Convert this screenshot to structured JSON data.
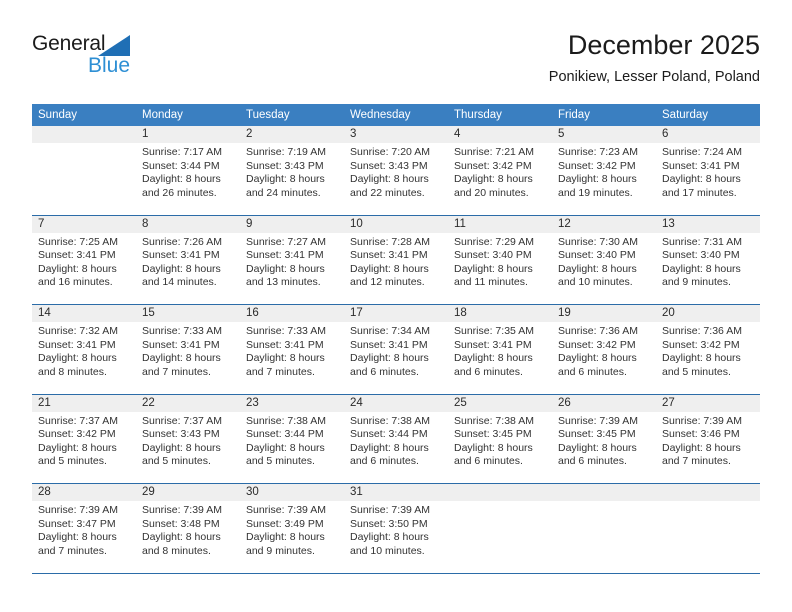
{
  "brand": {
    "name_top": "General",
    "name_bottom": "Blue",
    "accent_color": "#2e8fd4",
    "triangle_color": "#1f6fb5"
  },
  "header": {
    "month_title": "December 2025",
    "location": "Ponikiew, Lesser Poland, Poland"
  },
  "theme": {
    "header_bar_color": "#3a7fc1",
    "row_separator_color": "#2b6ca8",
    "day_band_color": "#efefef"
  },
  "weekdays": [
    "Sunday",
    "Monday",
    "Tuesday",
    "Wednesday",
    "Thursday",
    "Friday",
    "Saturday"
  ],
  "weeks": [
    [
      {
        "day": "",
        "sunrise": "",
        "sunset": "",
        "daylight_line1": "",
        "daylight_line2": "",
        "empty": true
      },
      {
        "day": "1",
        "sunrise": "Sunrise: 7:17 AM",
        "sunset": "Sunset: 3:44 PM",
        "daylight_line1": "Daylight: 8 hours",
        "daylight_line2": "and 26 minutes."
      },
      {
        "day": "2",
        "sunrise": "Sunrise: 7:19 AM",
        "sunset": "Sunset: 3:43 PM",
        "daylight_line1": "Daylight: 8 hours",
        "daylight_line2": "and 24 minutes."
      },
      {
        "day": "3",
        "sunrise": "Sunrise: 7:20 AM",
        "sunset": "Sunset: 3:43 PM",
        "daylight_line1": "Daylight: 8 hours",
        "daylight_line2": "and 22 minutes."
      },
      {
        "day": "4",
        "sunrise": "Sunrise: 7:21 AM",
        "sunset": "Sunset: 3:42 PM",
        "daylight_line1": "Daylight: 8 hours",
        "daylight_line2": "and 20 minutes."
      },
      {
        "day": "5",
        "sunrise": "Sunrise: 7:23 AM",
        "sunset": "Sunset: 3:42 PM",
        "daylight_line1": "Daylight: 8 hours",
        "daylight_line2": "and 19 minutes."
      },
      {
        "day": "6",
        "sunrise": "Sunrise: 7:24 AM",
        "sunset": "Sunset: 3:41 PM",
        "daylight_line1": "Daylight: 8 hours",
        "daylight_line2": "and 17 minutes."
      }
    ],
    [
      {
        "day": "7",
        "sunrise": "Sunrise: 7:25 AM",
        "sunset": "Sunset: 3:41 PM",
        "daylight_line1": "Daylight: 8 hours",
        "daylight_line2": "and 16 minutes."
      },
      {
        "day": "8",
        "sunrise": "Sunrise: 7:26 AM",
        "sunset": "Sunset: 3:41 PM",
        "daylight_line1": "Daylight: 8 hours",
        "daylight_line2": "and 14 minutes."
      },
      {
        "day": "9",
        "sunrise": "Sunrise: 7:27 AM",
        "sunset": "Sunset: 3:41 PM",
        "daylight_line1": "Daylight: 8 hours",
        "daylight_line2": "and 13 minutes."
      },
      {
        "day": "10",
        "sunrise": "Sunrise: 7:28 AM",
        "sunset": "Sunset: 3:41 PM",
        "daylight_line1": "Daylight: 8 hours",
        "daylight_line2": "and 12 minutes."
      },
      {
        "day": "11",
        "sunrise": "Sunrise: 7:29 AM",
        "sunset": "Sunset: 3:40 PM",
        "daylight_line1": "Daylight: 8 hours",
        "daylight_line2": "and 11 minutes."
      },
      {
        "day": "12",
        "sunrise": "Sunrise: 7:30 AM",
        "sunset": "Sunset: 3:40 PM",
        "daylight_line1": "Daylight: 8 hours",
        "daylight_line2": "and 10 minutes."
      },
      {
        "day": "13",
        "sunrise": "Sunrise: 7:31 AM",
        "sunset": "Sunset: 3:40 PM",
        "daylight_line1": "Daylight: 8 hours",
        "daylight_line2": "and 9 minutes."
      }
    ],
    [
      {
        "day": "14",
        "sunrise": "Sunrise: 7:32 AM",
        "sunset": "Sunset: 3:41 PM",
        "daylight_line1": "Daylight: 8 hours",
        "daylight_line2": "and 8 minutes."
      },
      {
        "day": "15",
        "sunrise": "Sunrise: 7:33 AM",
        "sunset": "Sunset: 3:41 PM",
        "daylight_line1": "Daylight: 8 hours",
        "daylight_line2": "and 7 minutes."
      },
      {
        "day": "16",
        "sunrise": "Sunrise: 7:33 AM",
        "sunset": "Sunset: 3:41 PM",
        "daylight_line1": "Daylight: 8 hours",
        "daylight_line2": "and 7 minutes."
      },
      {
        "day": "17",
        "sunrise": "Sunrise: 7:34 AM",
        "sunset": "Sunset: 3:41 PM",
        "daylight_line1": "Daylight: 8 hours",
        "daylight_line2": "and 6 minutes."
      },
      {
        "day": "18",
        "sunrise": "Sunrise: 7:35 AM",
        "sunset": "Sunset: 3:41 PM",
        "daylight_line1": "Daylight: 8 hours",
        "daylight_line2": "and 6 minutes."
      },
      {
        "day": "19",
        "sunrise": "Sunrise: 7:36 AM",
        "sunset": "Sunset: 3:42 PM",
        "daylight_line1": "Daylight: 8 hours",
        "daylight_line2": "and 6 minutes."
      },
      {
        "day": "20",
        "sunrise": "Sunrise: 7:36 AM",
        "sunset": "Sunset: 3:42 PM",
        "daylight_line1": "Daylight: 8 hours",
        "daylight_line2": "and 5 minutes."
      }
    ],
    [
      {
        "day": "21",
        "sunrise": "Sunrise: 7:37 AM",
        "sunset": "Sunset: 3:42 PM",
        "daylight_line1": "Daylight: 8 hours",
        "daylight_line2": "and 5 minutes."
      },
      {
        "day": "22",
        "sunrise": "Sunrise: 7:37 AM",
        "sunset": "Sunset: 3:43 PM",
        "daylight_line1": "Daylight: 8 hours",
        "daylight_line2": "and 5 minutes."
      },
      {
        "day": "23",
        "sunrise": "Sunrise: 7:38 AM",
        "sunset": "Sunset: 3:44 PM",
        "daylight_line1": "Daylight: 8 hours",
        "daylight_line2": "and 5 minutes."
      },
      {
        "day": "24",
        "sunrise": "Sunrise: 7:38 AM",
        "sunset": "Sunset: 3:44 PM",
        "daylight_line1": "Daylight: 8 hours",
        "daylight_line2": "and 6 minutes."
      },
      {
        "day": "25",
        "sunrise": "Sunrise: 7:38 AM",
        "sunset": "Sunset: 3:45 PM",
        "daylight_line1": "Daylight: 8 hours",
        "daylight_line2": "and 6 minutes."
      },
      {
        "day": "26",
        "sunrise": "Sunrise: 7:39 AM",
        "sunset": "Sunset: 3:45 PM",
        "daylight_line1": "Daylight: 8 hours",
        "daylight_line2": "and 6 minutes."
      },
      {
        "day": "27",
        "sunrise": "Sunrise: 7:39 AM",
        "sunset": "Sunset: 3:46 PM",
        "daylight_line1": "Daylight: 8 hours",
        "daylight_line2": "and 7 minutes."
      }
    ],
    [
      {
        "day": "28",
        "sunrise": "Sunrise: 7:39 AM",
        "sunset": "Sunset: 3:47 PM",
        "daylight_line1": "Daylight: 8 hours",
        "daylight_line2": "and 7 minutes."
      },
      {
        "day": "29",
        "sunrise": "Sunrise: 7:39 AM",
        "sunset": "Sunset: 3:48 PM",
        "daylight_line1": "Daylight: 8 hours",
        "daylight_line2": "and 8 minutes."
      },
      {
        "day": "30",
        "sunrise": "Sunrise: 7:39 AM",
        "sunset": "Sunset: 3:49 PM",
        "daylight_line1": "Daylight: 8 hours",
        "daylight_line2": "and 9 minutes."
      },
      {
        "day": "31",
        "sunrise": "Sunrise: 7:39 AM",
        "sunset": "Sunset: 3:50 PM",
        "daylight_line1": "Daylight: 8 hours",
        "daylight_line2": "and 10 minutes."
      },
      {
        "day": "",
        "sunrise": "",
        "sunset": "",
        "daylight_line1": "",
        "daylight_line2": "",
        "empty": true
      },
      {
        "day": "",
        "sunrise": "",
        "sunset": "",
        "daylight_line1": "",
        "daylight_line2": "",
        "empty": true
      },
      {
        "day": "",
        "sunrise": "",
        "sunset": "",
        "daylight_line1": "",
        "daylight_line2": "",
        "empty": true
      }
    ]
  ]
}
